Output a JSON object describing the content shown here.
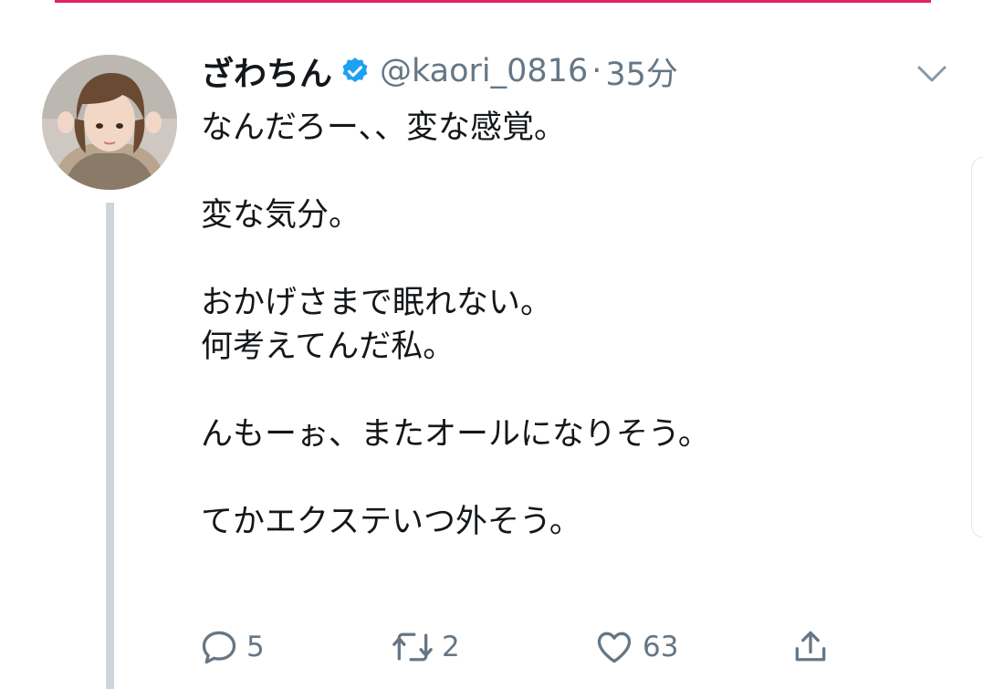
{
  "tweet": {
    "author": {
      "display_name": "ざわちん",
      "verified": true,
      "handle": "@kaori_0816",
      "separator": "·",
      "time": "35分"
    },
    "lines": [
      "なんだろー、、変な感覚。",
      "",
      "変な気分。",
      "",
      "おかげさまで眠れない。",
      "何考えてんだ私。",
      "",
      "んもーぉ、またオールになりそう。",
      "",
      "てかエクステいつ外そう。"
    ],
    "actions": {
      "reply_count": "5",
      "retweet_count": "2",
      "like_count": "63"
    }
  },
  "colors": {
    "text": "#14171a",
    "secondary": "#657786",
    "verified_blue": "#1da1f2",
    "thread_line": "#ccd6dd",
    "top_bar": "#e0245e"
  },
  "icons": {
    "verified": "verified-badge-icon",
    "menu": "chevron-down-icon",
    "reply": "reply-icon",
    "retweet": "retweet-icon",
    "like": "heart-icon",
    "share": "share-icon"
  }
}
